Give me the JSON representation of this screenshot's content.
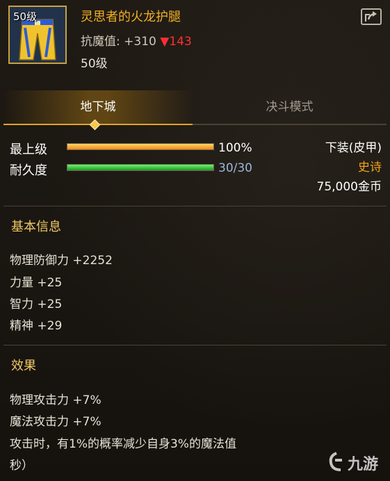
{
  "item": {
    "icon_level": "50级",
    "name": "灵思者的火龙护腿",
    "stat_label": "抗魔值: +310",
    "stat_change": "▼143",
    "level": "50级"
  },
  "tabs": [
    {
      "label": "地下城",
      "active": true
    },
    {
      "label": "决斗模式",
      "active": false
    }
  ],
  "bars": {
    "top_level": {
      "label": "最上级",
      "value_text": "100%",
      "fill": 1.0
    },
    "durability": {
      "label": "耐久度",
      "value_text": "30/30",
      "fill": 1.0
    }
  },
  "info": {
    "slot": "下装(皮甲)",
    "rarity": "史诗",
    "price": "75,000金币"
  },
  "basic": {
    "title": "基本信息",
    "lines": [
      "物理防御力 +2252",
      "力量 +25",
      "智力 +25",
      "精神 +29"
    ]
  },
  "effects": {
    "title": "效果",
    "lines": [
      "物理攻击力 +7%",
      "魔法攻击力 +7%",
      "攻击时，有1%的概率减少自身3%的魔法值",
      "秒）"
    ]
  },
  "watermark": "九游",
  "colors": {
    "title_gold": "#f0b024",
    "rarity_orange": "#f3a21a",
    "stat_red": "#ff3030",
    "section_gold": "#f0c865",
    "durability_blue": "#9cb7d8"
  }
}
